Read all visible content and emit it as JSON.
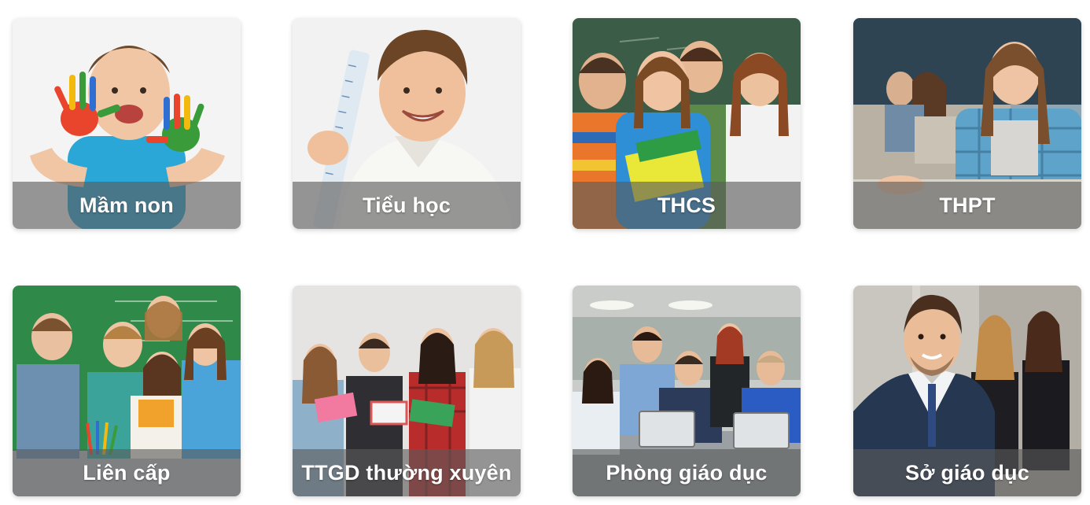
{
  "levels": [
    {
      "label": "Mầm non",
      "photo": "child-painted-hands-photo"
    },
    {
      "label": "Tiểu học",
      "photo": "boy-with-ruler-photo"
    },
    {
      "label": "THCS",
      "photo": "teen-students-chalkboard-photo"
    },
    {
      "label": "THPT",
      "photo": "girl-writing-classroom-photo"
    },
    {
      "label": "Liên cấp",
      "photo": "kids-and-teacher-chalkboard-photo"
    },
    {
      "label": "TTGD thường xuyên",
      "photo": "teens-reading-books-photo"
    },
    {
      "label": "Phòng giáo dục",
      "photo": "office-laptops-meeting-photo"
    },
    {
      "label": "Sở giáo dục",
      "photo": "businessman-office-photo"
    }
  ],
  "colors": {
    "caption_overlay": "#5a5a5a",
    "caption_text": "#ffffff"
  }
}
